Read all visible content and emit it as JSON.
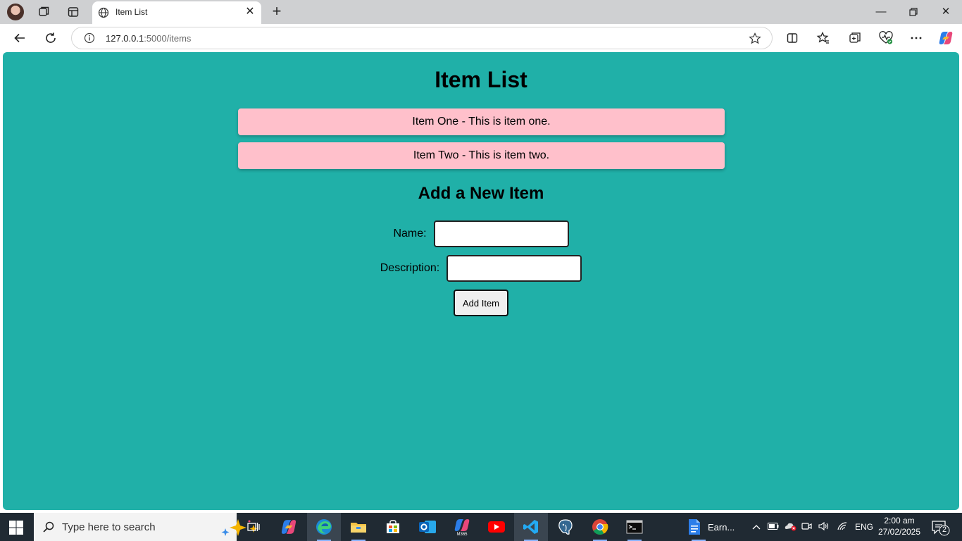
{
  "browser": {
    "tab": {
      "title": "Item List"
    },
    "address": {
      "host": "127.0.0.1",
      "path": ":5000/items"
    }
  },
  "page": {
    "title": "Item List",
    "items": [
      "Item One - This is item one.",
      "Item Two - This is item two."
    ],
    "form": {
      "heading": "Add a New Item",
      "name_label": "Name:",
      "name_value": "",
      "description_label": "Description:",
      "description_value": "",
      "submit_label": "Add Item"
    },
    "colors": {
      "background": "#20b0a8",
      "item_bg": "#ffc0cb"
    }
  },
  "taskbar": {
    "search_placeholder": "Type here to search",
    "pinned_doc_label": "Earn...",
    "language": "ENG",
    "time": "2:00 am",
    "date": "27/02/2025",
    "notification_count": "2"
  }
}
